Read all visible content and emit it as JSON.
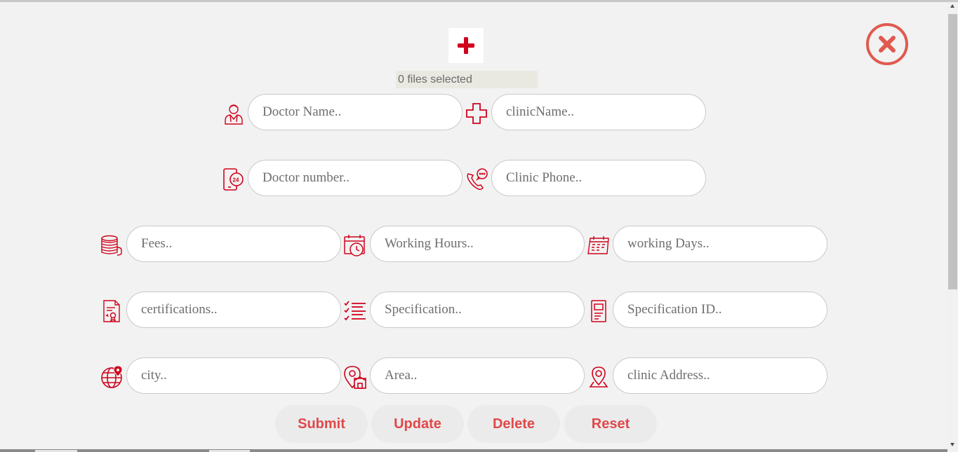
{
  "upload": {
    "status": "0 files selected",
    "icon": "plus-icon"
  },
  "close_icon": "close-circle-icon",
  "fields": {
    "doctor_name": {
      "placeholder": "Doctor Name..",
      "value": "",
      "icon": "doctor-icon"
    },
    "clinic_name": {
      "placeholder": "clinicName..",
      "value": "",
      "icon": "medical-cross-icon"
    },
    "doctor_number": {
      "placeholder": "Doctor number..",
      "value": "",
      "icon": "phone-24-icon"
    },
    "clinic_phone": {
      "placeholder": "Clinic Phone..",
      "value": "",
      "icon": "phone-chat-icon"
    },
    "fees": {
      "placeholder": "Fees..",
      "value": "",
      "icon": "coins-icon"
    },
    "working_hours": {
      "placeholder": "Working Hours..",
      "value": "",
      "icon": "calendar-clock-icon"
    },
    "working_days": {
      "placeholder": "working Days..",
      "value": "",
      "icon": "calendar-icon"
    },
    "certifications": {
      "placeholder": "certifications..",
      "value": "",
      "icon": "certificate-icon"
    },
    "specification": {
      "placeholder": "Specification..",
      "value": "",
      "icon": "checklist-icon"
    },
    "specification_id": {
      "placeholder": "Specification ID..",
      "value": "",
      "icon": "id-card-icon"
    },
    "city": {
      "placeholder": "city..",
      "value": "",
      "icon": "globe-pin-icon"
    },
    "area": {
      "placeholder": "Area..",
      "value": "",
      "icon": "map-pin-building-icon"
    },
    "clinic_address": {
      "placeholder": "clinic Address..",
      "value": "",
      "icon": "location-pin-icon"
    }
  },
  "buttons": {
    "submit": "Submit",
    "update": "Update",
    "delete": "Delete",
    "reset": "Reset"
  },
  "colors": {
    "accent": "#d0021b",
    "button_text": "#e0484b",
    "close": "#e05a50",
    "background": "#f2f2f2"
  }
}
